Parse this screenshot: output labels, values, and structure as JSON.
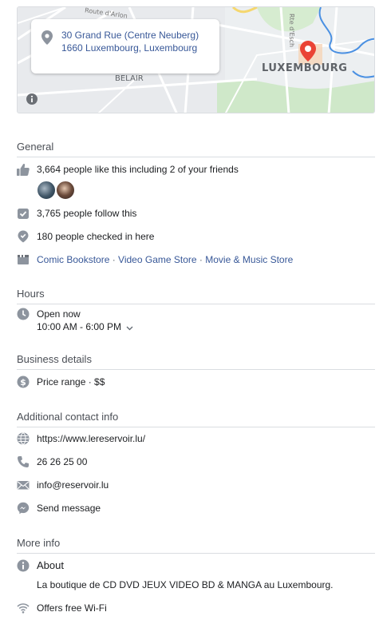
{
  "map": {
    "address": "30 Grand Rue (Centre Neuberg) 1660 Luxembourg, Luxembourg",
    "city_label": "LUXEMBOURG",
    "area_label": "BELAIR",
    "road_label_1": "Route d'Arlon",
    "road_label_2": "Rte d'Esch",
    "marker_color": "#ea4335"
  },
  "general": {
    "title": "General",
    "likes": "3,664 people like this including 2 of your friends",
    "follows": "3,765 people follow this",
    "checkins": "180 people checked in here",
    "categories": [
      "Comic Bookstore",
      "Video Game Store",
      "Movie & Music Store"
    ],
    "separator": " · "
  },
  "hours": {
    "title": "Hours",
    "status": "Open now",
    "range": "10:00 AM - 6:00 PM"
  },
  "business": {
    "title": "Business details",
    "price_range": "Price range · $$"
  },
  "contact": {
    "title": "Additional contact info",
    "website": "https://www.lereservoir.lu/",
    "phone": "26 26 25 00",
    "email": "info@reservoir.lu",
    "message": "Send message"
  },
  "more": {
    "title": "More info",
    "about_label": "About",
    "about_text": "La boutique de CD DVD JEUX VIDEO BD & MANGA au Luxembourg.",
    "wifi": "Offers free Wi-Fi"
  },
  "colors": {
    "link": "#385898",
    "open_green": "#42b72a",
    "icon_gray": "#8d949e"
  }
}
